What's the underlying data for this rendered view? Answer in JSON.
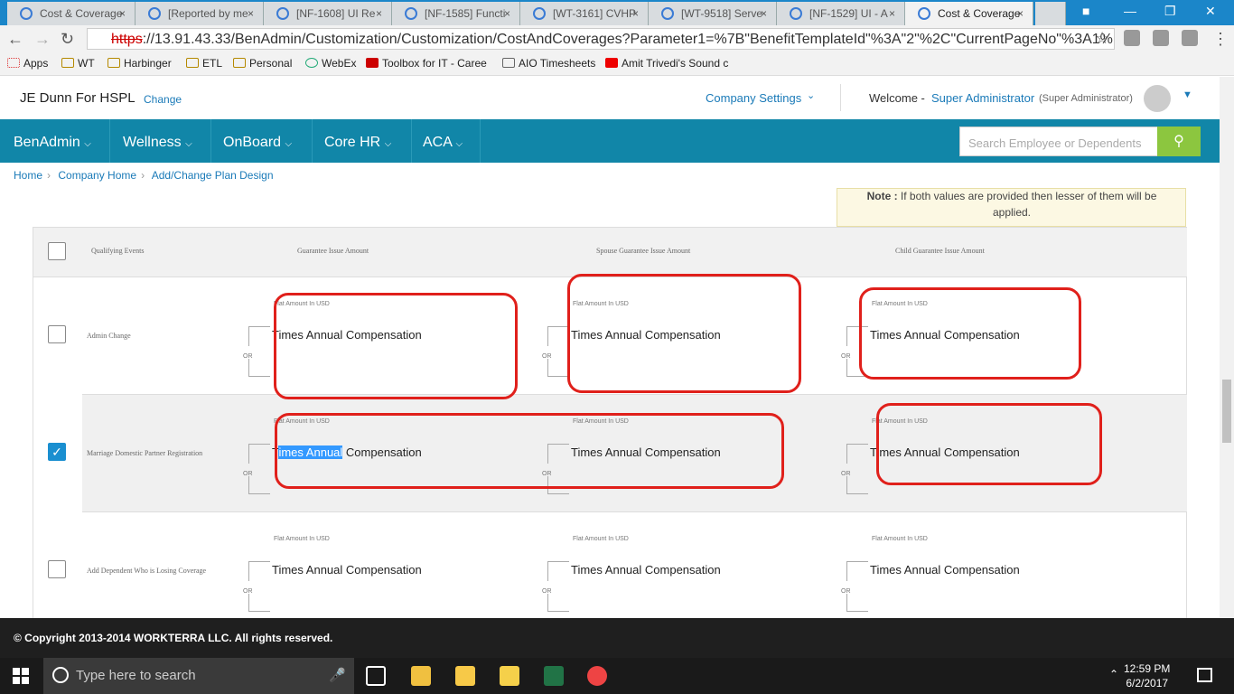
{
  "browser": {
    "tabs": [
      {
        "label": "Cost & Coverage"
      },
      {
        "label": "[Reported by me"
      },
      {
        "label": "[NF-1608] UI Re"
      },
      {
        "label": "[NF-1585] Functi"
      },
      {
        "label": "[WT-3161] CVHP"
      },
      {
        "label": "[WT-9518] Serve"
      },
      {
        "label": "[NF-1529] UI - A"
      },
      {
        "label": "Cost & Coverage"
      }
    ],
    "tab_close": "×",
    "url_scheme": "https",
    "url_rest": "://13.91.43.33/BenAdmin/Customization/Customization/CostAndCoverages?Parameter1=%7B\"BenefitTemplateId\"%3A\"2\"%2C\"CurrentPageNo\"%3A1%",
    "bookmarks": [
      "Apps",
      "WT",
      "Harbinger",
      "ETL",
      "Personal",
      "WebEx",
      "Toolbox for IT - Caree",
      "AIO Timesheets",
      "Amit Trivedi's Sound c"
    ]
  },
  "app": {
    "company": "JE Dunn For HSPL",
    "change_link": "Change",
    "company_settings": "Company Settings",
    "welcome_prefix": "Welcome -",
    "user_name": "Super Administrator",
    "user_role": "(Super Administrator)",
    "nav": [
      "BenAdmin",
      "Wellness",
      "OnBoard",
      "Core HR",
      "ACA"
    ],
    "search_placeholder": "Search Employee or Dependents",
    "breadcrumb": [
      "Home",
      "Company Home",
      "Add/Change Plan Design"
    ]
  },
  "note": {
    "bold": "Note :",
    "text": " If both values are provided then lesser of them will be applied."
  },
  "table": {
    "headers": {
      "events": "Qualifying Events",
      "guarantee": "Guarantee Issue Amount",
      "spouse": "Spouse Guarantee Issue Amount",
      "child": "Child Guarantee Issue Amount"
    },
    "flat_label": "Flat Amount In USD",
    "tac_label": "Times Annual Compensation",
    "tac_highlight": "imes Annual",
    "tac_prefix": "T",
    "tac_suffix": " Compensation",
    "or_label": "OR",
    "rows": [
      {
        "event": "Admin Change",
        "checked": false
      },
      {
        "event": "Marriage Domestic Partner Registration",
        "checked": true
      },
      {
        "event": "Add Dependent Who is Losing Coverage",
        "checked": false
      }
    ]
  },
  "footer": {
    "copyright": "© Copyright 2013-2014 WORKTERRA LLC. All rights reserved."
  },
  "taskbar": {
    "search_placeholder": "Type here to search",
    "time": "12:59 PM",
    "date": "6/2/2017"
  }
}
